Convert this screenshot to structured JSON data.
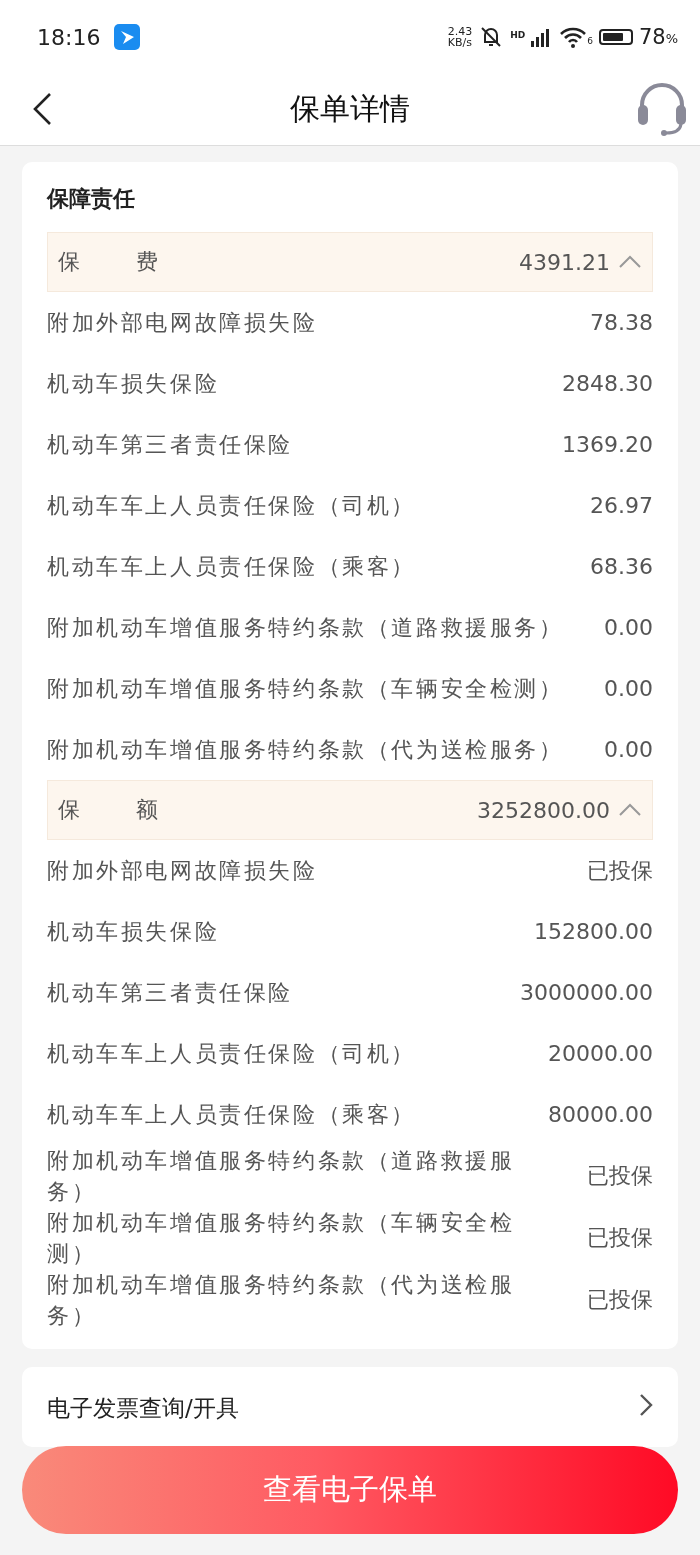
{
  "status_bar": {
    "time": "18:16",
    "net_speed": "2.43",
    "net_unit": "KB/s",
    "hd": "HD",
    "wifi_label": "6",
    "battery": "78",
    "battery_unit": "%"
  },
  "header": {
    "title": "保单详情"
  },
  "card": {
    "title": "保障责任",
    "sections": [
      {
        "label": "保费",
        "total": "4391.21",
        "expanded": true,
        "rows": [
          {
            "name": "附加外部电网故障损失险",
            "value": "78.38"
          },
          {
            "name": "机动车损失保险",
            "value": "2848.30"
          },
          {
            "name": "机动车第三者责任保险",
            "value": "1369.20"
          },
          {
            "name": "机动车车上人员责任保险（司机）",
            "value": "26.97"
          },
          {
            "name": "机动车车上人员责任保险（乘客）",
            "value": "68.36"
          },
          {
            "name": "附加机动车增值服务特约条款（道路救援服务）",
            "value": "0.00"
          },
          {
            "name": "附加机动车增值服务特约条款（车辆安全检测）",
            "value": "0.00"
          },
          {
            "name": "附加机动车增值服务特约条款（代为送检服务）",
            "value": "0.00"
          }
        ]
      },
      {
        "label": "保额",
        "total": "3252800.00",
        "expanded": true,
        "rows": [
          {
            "name": "附加外部电网故障损失险",
            "value": "已投保"
          },
          {
            "name": "机动车损失保险",
            "value": "152800.00"
          },
          {
            "name": "机动车第三者责任保险",
            "value": "3000000.00"
          },
          {
            "name": "机动车车上人员责任保险（司机）",
            "value": "20000.00"
          },
          {
            "name": "机动车车上人员责任保险（乘客）",
            "value": "80000.00"
          },
          {
            "name": "附加机动车增值服务特约条款（道路救援服务）",
            "value": "已投保"
          },
          {
            "name": "附加机动车增值服务特约条款（车辆安全检测）",
            "value": "已投保"
          },
          {
            "name": "附加机动车增值服务特约条款（代为送检服务）",
            "value": "已投保"
          }
        ]
      }
    ]
  },
  "invoice": {
    "label": "电子发票查询/开具"
  },
  "primary_button": {
    "label": "查看电子保单"
  }
}
